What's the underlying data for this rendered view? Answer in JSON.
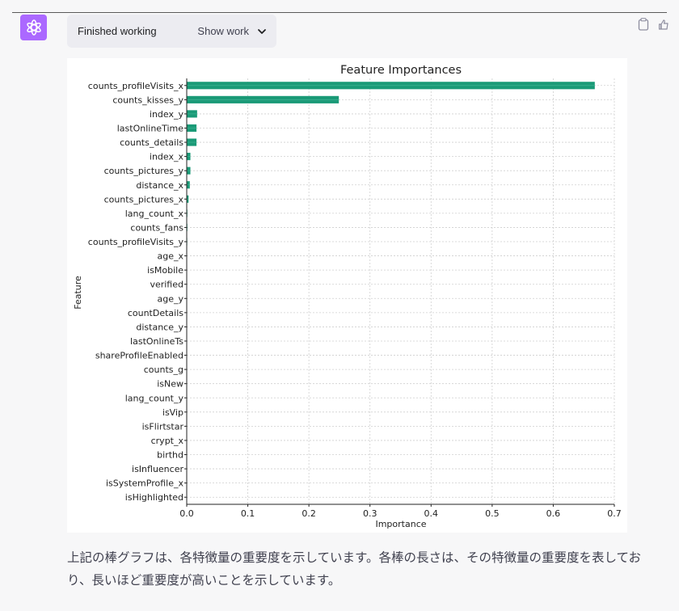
{
  "message": {
    "status_label": "Finished working",
    "show_work_label": "Show work",
    "answer_text": "上記の棒グラフは、各特徴量の重要度を示しています。各棒の長さは、その特徴量の重要度を表しており、長いほど重要度が高いことを示しています。"
  },
  "colors": {
    "avatar_bg": "#ab68ff",
    "bar": "#1a9a77"
  },
  "chart_data": {
    "type": "bar",
    "orientation": "horizontal",
    "title": "Feature Importances",
    "xlabel": "Importance",
    "ylabel": "Feature",
    "xlim": [
      0,
      0.7
    ],
    "xticks": [
      "0.0",
      "0.1",
      "0.2",
      "0.3",
      "0.4",
      "0.5",
      "0.6",
      "0.7"
    ],
    "grid": true,
    "categories": [
      "counts_profileVisits_x",
      "counts_kisses_y",
      "index_y",
      "lastOnlineTime",
      "counts_details",
      "index_x",
      "counts_pictures_y",
      "distance_x",
      "counts_pictures_x",
      "lang_count_x",
      "counts_fans",
      "counts_profileVisits_y",
      "age_x",
      "isMobile",
      "verified",
      "age_y",
      "countDetails",
      "distance_y",
      "lastOnlineTs",
      "shareProfileEnabled",
      "counts_g",
      "isNew",
      "lang_count_y",
      "isVip",
      "isFlirtstar",
      "crypt_x",
      "birthd",
      "isInfluencer",
      "isSystemProfile_x",
      "isHighlighted"
    ],
    "values": [
      0.668,
      0.249,
      0.017,
      0.016,
      0.016,
      0.006,
      0.006,
      0.005,
      0.003,
      0.001,
      0.001,
      0.0008,
      0.0006,
      0.0005,
      0.0004,
      0.0003,
      0.0003,
      0.0002,
      0.0002,
      0.0002,
      0.0001,
      0.0001,
      0.0001,
      0.0001,
      0.0001,
      0.0001,
      0.0001,
      5e-05,
      5e-05,
      5e-05
    ]
  }
}
